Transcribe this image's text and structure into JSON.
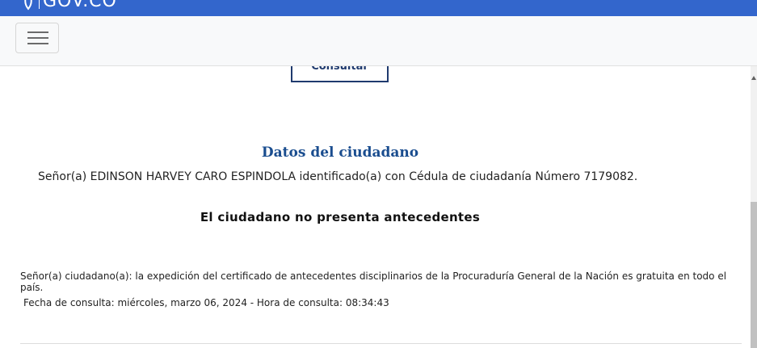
{
  "header": {
    "logo_text": "GOV.CO",
    "brand_color": "#3366cc"
  },
  "navbar": {
    "menu_icon": "hamburger-menu-icon"
  },
  "form": {
    "consult_button_label": "Consultar"
  },
  "result": {
    "section_title": "Datos del ciudadano",
    "citizen_line": "Señor(a)  EDINSON HARVEY CARO ESPINDOLA identificado(a) con Cédula de ciudadanía Número 7179082.",
    "status": "El ciudadano no presenta antecedentes",
    "notice": "Señor(a) ciudadano(a): la expedición del certificado de antecedentes disciplinarios de la Procuraduría General de la Nación es gratuita en todo el país.",
    "consult_date_line": "Fecha de consulta: miércoles, marzo 06, 2024 - Hora de consulta: 08:34:43",
    "title_color": "#1a4d8f"
  }
}
